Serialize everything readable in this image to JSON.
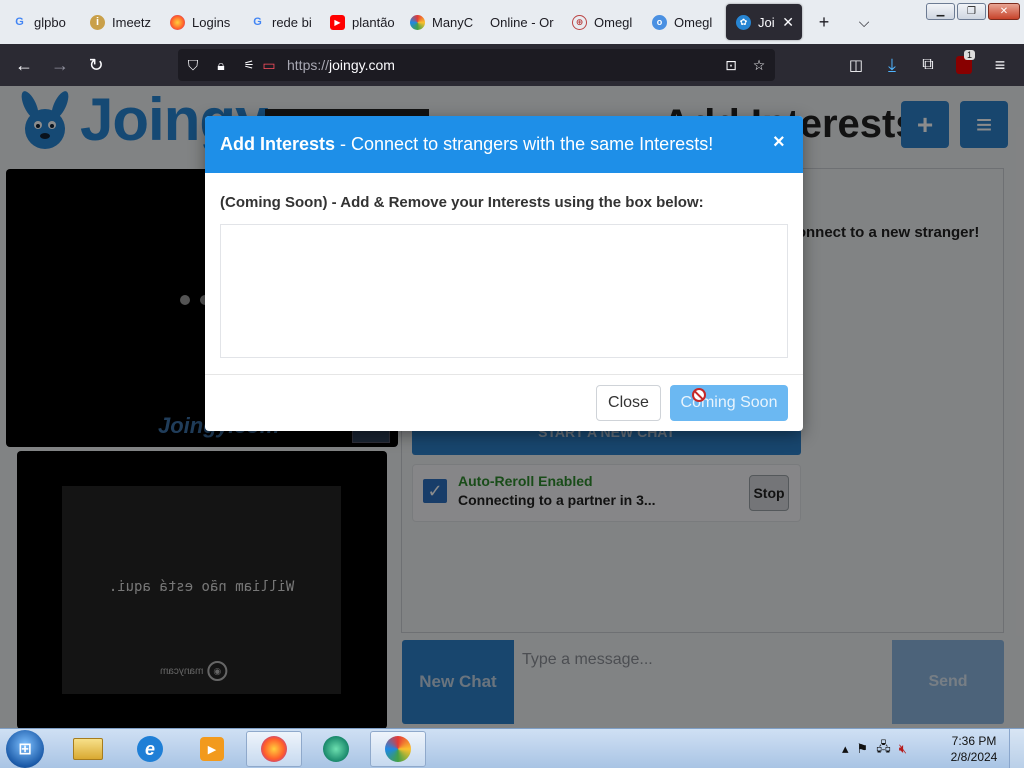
{
  "browser": {
    "tabs": [
      {
        "label": "glpbo",
        "icon": "google-icon",
        "active": false
      },
      {
        "label": "Imeetz",
        "icon": "imeetzu-icon",
        "active": false
      },
      {
        "label": "Logins",
        "icon": "firefox-icon",
        "active": false
      },
      {
        "label": "rede bi",
        "icon": "google-icon",
        "active": false
      },
      {
        "label": "plantão",
        "icon": "youtube-icon",
        "active": false
      },
      {
        "label": "ManyC",
        "icon": "manycam-icon",
        "active": false
      },
      {
        "label": "Online - Or",
        "icon": "none",
        "active": false
      },
      {
        "label": "Omegl",
        "icon": "globe-icon",
        "active": false
      },
      {
        "label": "Omegl",
        "icon": "omegle-icon",
        "active": false
      },
      {
        "label": "Joing",
        "icon": "joingy-bunny-icon",
        "active": true
      }
    ],
    "new_tab_symbol": "+",
    "tab_list_symbol": "⌵",
    "url_protocol": "https://",
    "url_host": "joingy.com",
    "extension_badge": "1"
  },
  "site": {
    "logo_text": "Joingy",
    "header_interests_text": "Add Interests",
    "add_button_symbol": "+",
    "menu_button_symbol": "≡",
    "chat_prompt": "Connect to a new stranger!",
    "video_watermark": "Joingy.com",
    "camera_overlay_text": "William não está aqui.",
    "camera_logo_text": "manycam",
    "start_button": "START A NEW CHAT",
    "reroll_title": "Auto-Reroll Enabled",
    "reroll_status": "Connecting to a partner in 3...",
    "stop_button": "Stop",
    "new_chat_button": "New Chat",
    "message_placeholder": "Type a message...",
    "send_button": "Send"
  },
  "modal": {
    "title_bold": "Add Interests",
    "title_rest": " - Connect to strangers with the same Interests!",
    "close_symbol": "×",
    "body_text": "(Coming Soon) - Add & Remove your Interests using the box below:",
    "close_button": "Close",
    "coming_soon_button": "Coming Soon"
  },
  "taskbar": {
    "time": "7:36 PM",
    "date": "2/8/2024",
    "items": [
      "explorer-icon",
      "internet-explorer-icon",
      "media-player-icon",
      "firefox-icon",
      "chat-app-icon",
      "manycam-icon"
    ]
  },
  "colors": {
    "brand_blue": "#2d80c8",
    "modal_header": "#1e8fe8",
    "reroll_green": "#2e8b2e"
  }
}
